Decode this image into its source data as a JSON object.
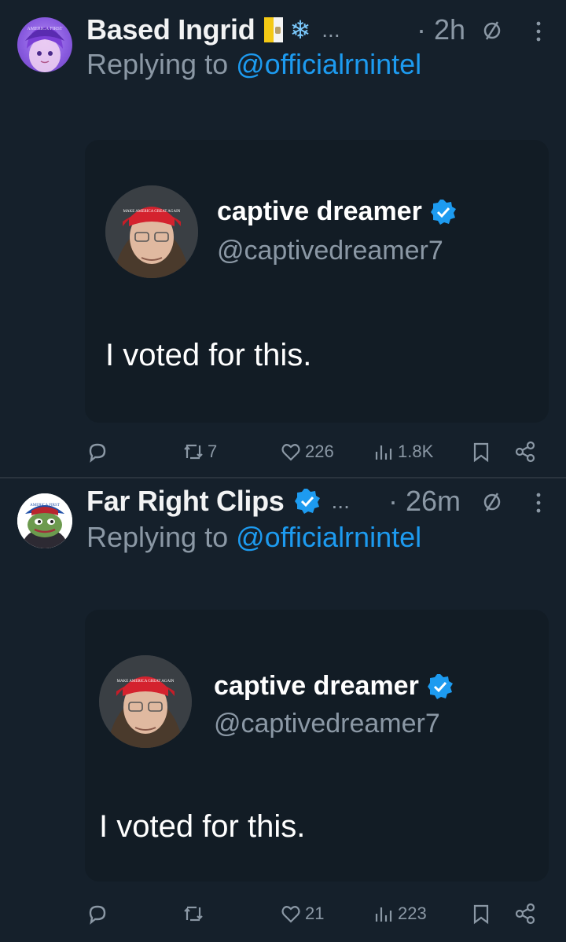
{
  "tweets": [
    {
      "author": "Based Ingrid",
      "time": "· 2h",
      "more": "...",
      "reply_prefix": "Replying to",
      "reply_handle": "@officialrnintel",
      "avatar_text": "AMERICA FIRST",
      "card": {
        "name": "captive dreamer",
        "handle": "@captivedreamer7",
        "text": "I voted for this.",
        "hat_text": "MAKE AMERICA GREAT AGAIN"
      },
      "actions": {
        "reply": "",
        "retweet": "7",
        "like": "226",
        "views": "1.8K"
      }
    },
    {
      "author": "Far Right Clips",
      "time": "· 26m",
      "more": "...",
      "reply_prefix": "Replying to",
      "reply_handle": "@officialrnintel",
      "avatar_text": "AMERICA FIRST",
      "card": {
        "name": "captive dreamer",
        "handle": "@captivedreamer7",
        "text": "I voted for this.",
        "hat_text": "MAKE AMERICA GREAT AGAIN"
      },
      "actions": {
        "reply": "",
        "retweet": "",
        "like": "21",
        "views": "223"
      }
    }
  ],
  "colors": {
    "background": "#15202b",
    "link": "#1d9bf0",
    "muted": "#8b98a5",
    "verified": "#1d9bf0"
  },
  "icons": [
    "reply-icon",
    "retweet-icon",
    "like-icon",
    "views-icon",
    "bookmark-icon",
    "share-icon",
    "mute-icon",
    "more-icon",
    "verified-icon",
    "snowflake-icon",
    "vatican-flag-icon"
  ]
}
